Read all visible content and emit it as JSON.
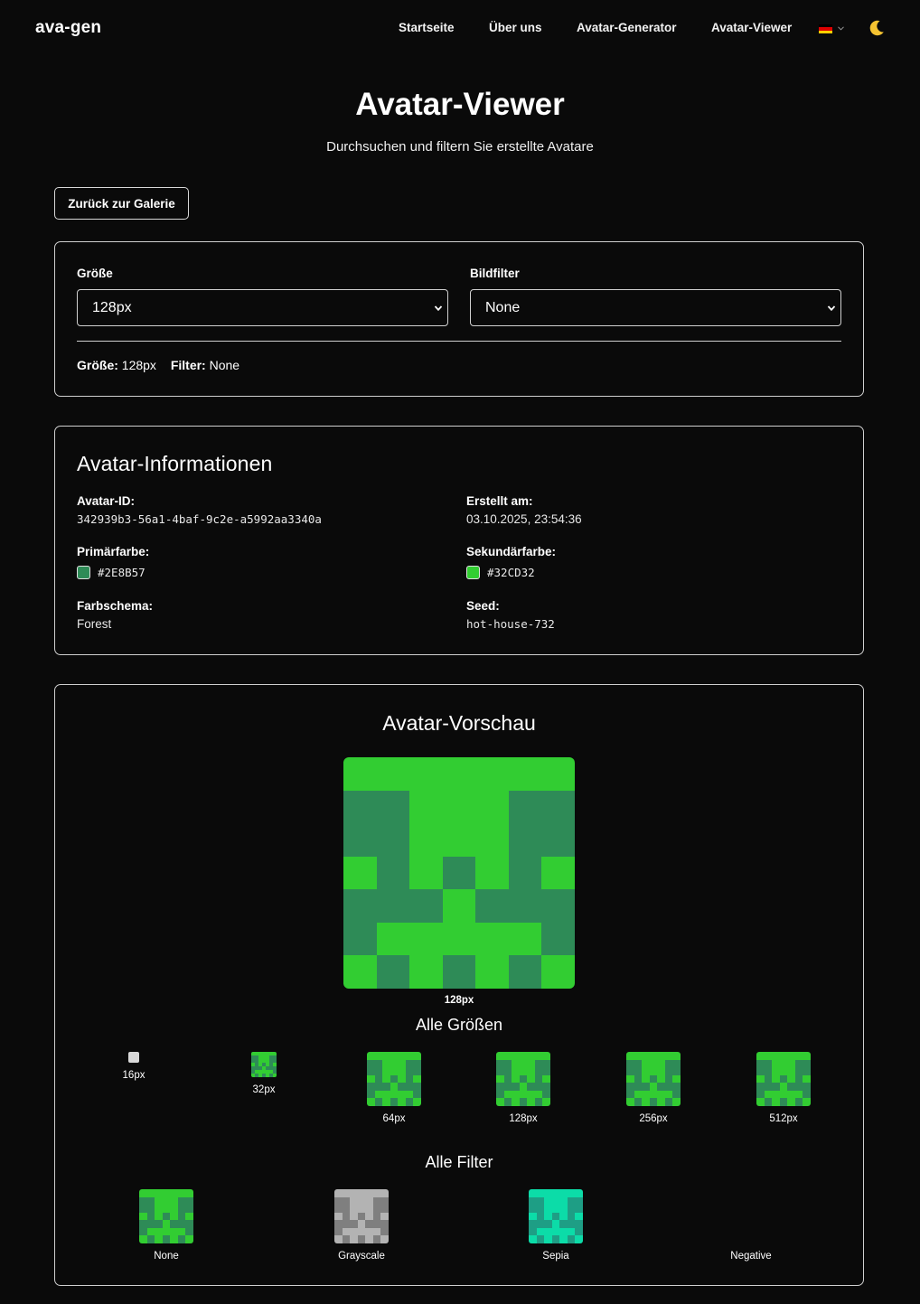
{
  "nav": {
    "brand": "ava-gen",
    "links": [
      "Startseite",
      "Über uns",
      "Avatar-Generator",
      "Avatar-Viewer"
    ]
  },
  "header": {
    "title": "Avatar-Viewer",
    "subtitle": "Durchsuchen und filtern Sie erstellte Avatare"
  },
  "back_button": "Zurück zur Galerie",
  "filters": {
    "size_label": "Größe",
    "size_value": "128px",
    "filter_label": "Bildfilter",
    "filter_value": "None",
    "summary_size_label": "Größe:",
    "summary_size_value": "128px",
    "summary_filter_label": "Filter:",
    "summary_filter_value": "None"
  },
  "info": {
    "title": "Avatar-Informationen",
    "id_label": "Avatar-ID:",
    "id_value": "342939b3-56a1-4baf-9c2e-a5992aa3340a",
    "created_label": "Erstellt am:",
    "created_value": "03.10.2025, 23:54:36",
    "primary_label": "Primärfarbe:",
    "primary_value": "#2E8B57",
    "secondary_label": "Sekundärfarbe:",
    "secondary_value": "#32CD32",
    "scheme_label": "Farbschema:",
    "scheme_value": "Forest",
    "seed_label": "Seed:",
    "seed_value": "hot-house-732"
  },
  "preview": {
    "title": "Avatar-Vorschau",
    "main_caption": "128px",
    "sizes_title": "Alle Größen",
    "sizes": [
      "16px",
      "32px",
      "64px",
      "128px",
      "256px",
      "512px"
    ],
    "filters_title": "Alle Filter",
    "filters": [
      "None",
      "Grayscale",
      "Sepia",
      "Negative"
    ]
  },
  "colors": {
    "primary": "#2E8B57",
    "secondary": "#32CD32",
    "gray_primary": "#7f7f7f",
    "gray_secondary": "#b3b3b3",
    "sepia_primary": "#1e9e85",
    "sepia_secondary": "#0cdca8"
  },
  "icons": {
    "flag": "german-flag-icon",
    "theme": "moon-icon",
    "select": "chevron-down-icon"
  },
  "avatar_pattern": [
    [
      1,
      1,
      1,
      1,
      1,
      1,
      1
    ],
    [
      0,
      0,
      1,
      1,
      1,
      0,
      0
    ],
    [
      0,
      0,
      1,
      1,
      1,
      0,
      0
    ],
    [
      1,
      0,
      1,
      0,
      1,
      0,
      1
    ],
    [
      0,
      0,
      0,
      1,
      0,
      0,
      0
    ],
    [
      0,
      1,
      1,
      1,
      1,
      1,
      0
    ],
    [
      1,
      0,
      1,
      0,
      1,
      0,
      1
    ]
  ]
}
